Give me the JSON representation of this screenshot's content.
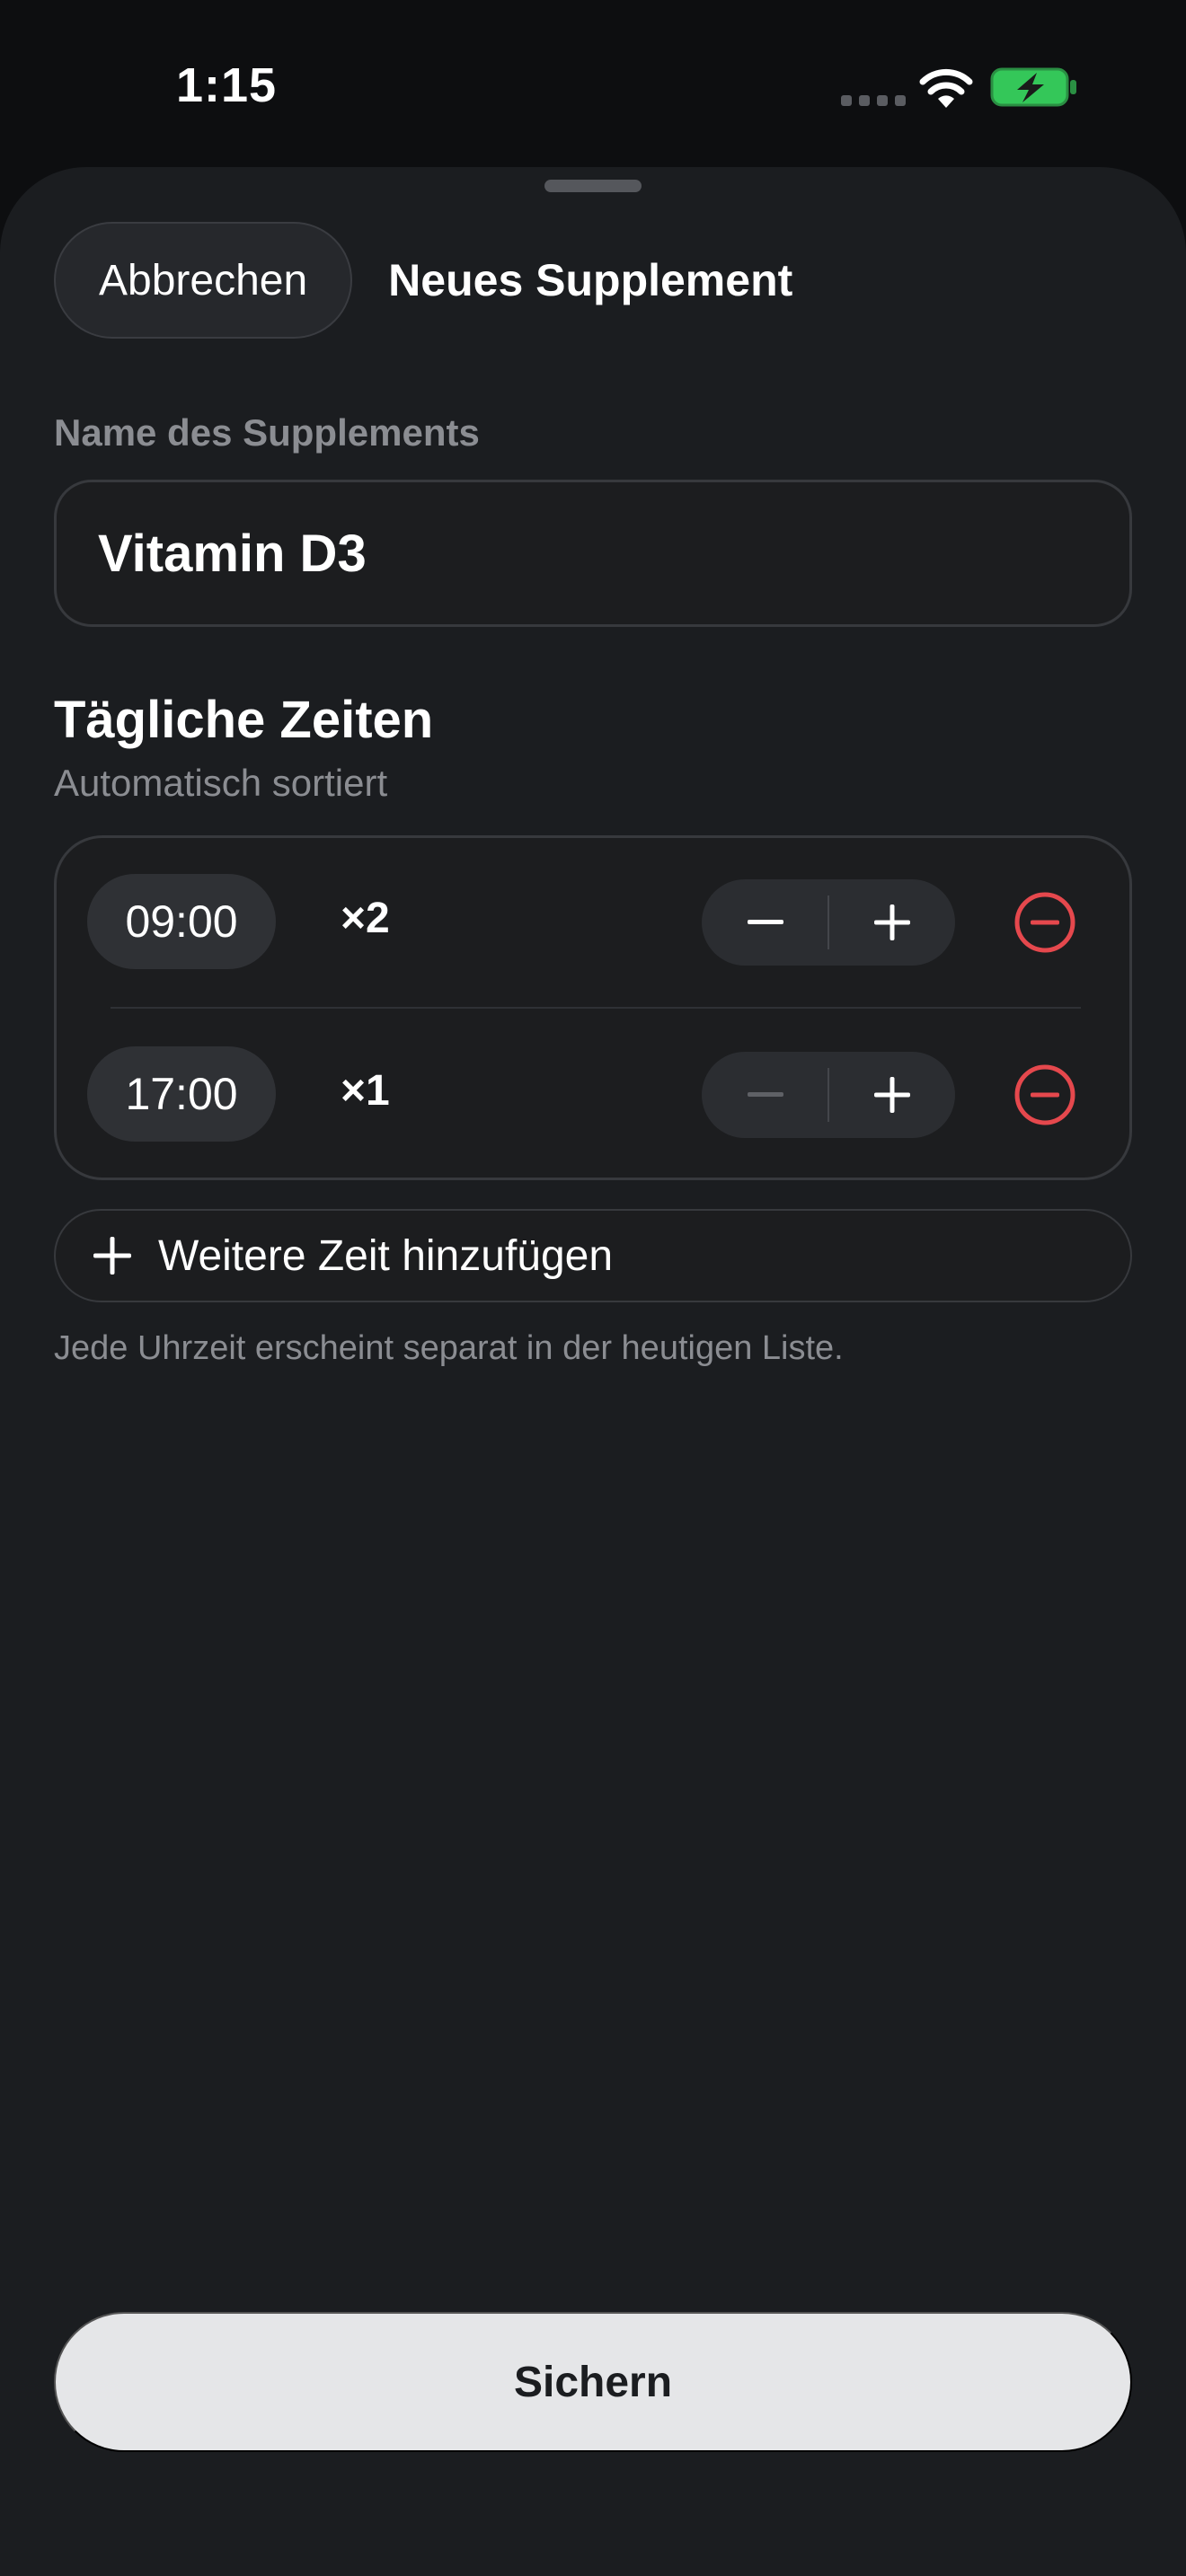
{
  "status_bar": {
    "time": "1:15"
  },
  "header": {
    "cancel_label": "Abbrechen",
    "title": "Neues Supplement"
  },
  "name_field": {
    "label": "Name des Supplements",
    "value": "Vitamin D3"
  },
  "times": {
    "title": "Tägliche Zeiten",
    "subtitle": "Automatisch sortiert",
    "rows": [
      {
        "time": "09:00",
        "count": "×2",
        "decrement_enabled": true
      },
      {
        "time": "17:00",
        "count": "×1",
        "decrement_enabled": false
      }
    ],
    "add_label": "Weitere Zeit hinzufügen",
    "hint": "Jede Uhrzeit erscheint separat in der heutigen Liste."
  },
  "save_label": "Sichern",
  "colors": {
    "background": "#1b1d20",
    "remove_accent": "#e5484d",
    "battery_green": "#34c759",
    "save_button": "#e5e6e8"
  },
  "icons": [
    "wifi-icon",
    "battery-charging-icon",
    "minus-icon",
    "plus-icon",
    "remove-circle-icon"
  ]
}
